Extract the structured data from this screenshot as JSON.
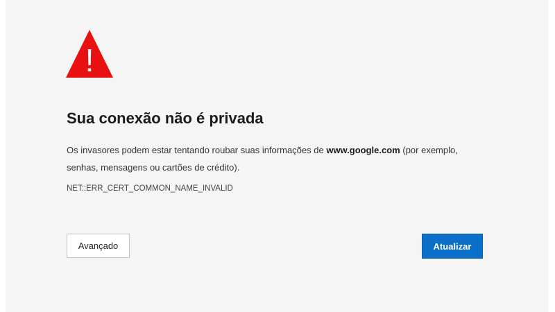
{
  "icons": {
    "warning": "warning-triangle-icon",
    "warning_color": "#e81010",
    "warning_mark": "!"
  },
  "error": {
    "title": "Sua conexão não é privada",
    "message_prefix": "Os invasores podem estar tentando roubar suas informações de ",
    "domain": "www.google.com",
    "message_suffix": " (por exemplo, senhas, mensagens ou cartões de crédito).",
    "code": "NET::ERR_CERT_COMMON_NAME_INVALID"
  },
  "buttons": {
    "advanced_label": "Avançado",
    "refresh_label": "Atualizar",
    "refresh_color": "#0a6fc9"
  },
  "colors": {
    "background": "#f5f5f5",
    "text": "#1b1b1b"
  }
}
